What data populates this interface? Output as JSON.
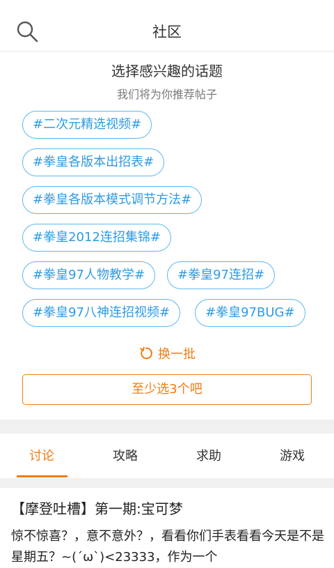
{
  "header": {
    "title": "社区",
    "search_icon": "search-icon"
  },
  "intro": {
    "title": "选择感兴趣的话题",
    "subtitle": "我们将为你推荐帖子"
  },
  "tags": [
    "#二次元精选视频#",
    "#拳皇各版本出招表#",
    "#拳皇各版本模式调节方法#",
    "#拳皇2012连招集锦#",
    "#拳皇97人物教学#",
    "#拳皇97连招#",
    "#拳皇97八神连招视频#",
    "#拳皇97BUG#"
  ],
  "refresh": {
    "label": "换一批",
    "icon": "refresh-icon"
  },
  "submit": {
    "label": "至少选3个吧"
  },
  "tabs": [
    {
      "label": "讨论",
      "active": true
    },
    {
      "label": "攻略",
      "active": false
    },
    {
      "label": "求助",
      "active": false
    },
    {
      "label": "游戏",
      "active": false
    }
  ],
  "post": {
    "title": "【摩登吐槽】第一期:宝可梦",
    "body": "惊不惊喜？，意不意外？，看看你们手表看看今天是不是星期五？~(ˊωˋ)<23333，作为一个"
  },
  "colors": {
    "accent": "#f07c13",
    "tag": "#2f9be3"
  }
}
